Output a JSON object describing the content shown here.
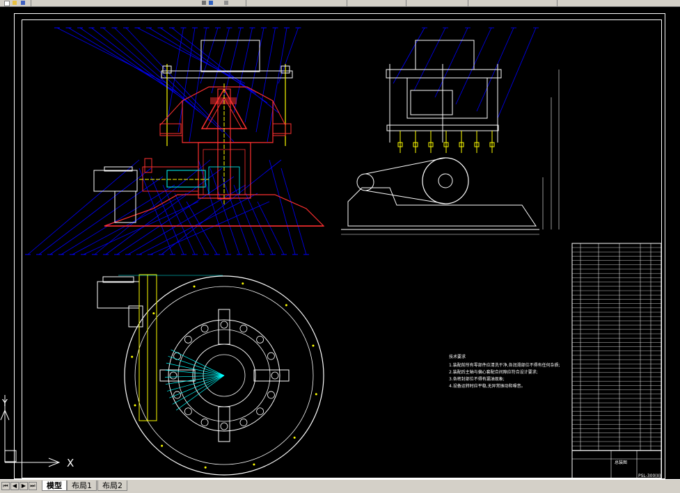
{
  "app": {
    "name": "AutoCAD"
  },
  "colors": {
    "background": "#000000",
    "leader": "#0000ff",
    "outline": "#ffffff",
    "section": "#ff3030",
    "machine": "#ffff00",
    "dim": "#00ffff",
    "center": "#00ff00"
  },
  "tabs": [
    {
      "label": "模型",
      "active": true
    },
    {
      "label": "布局1",
      "active": false
    },
    {
      "label": "布局2",
      "active": false
    }
  ],
  "ucs": {
    "x_label": "X",
    "y_label": "Y"
  },
  "notes": {
    "title": "技术要求",
    "lines": [
      "1.装配前所有零部件应清洗干净,各润滑部位不得有任何杂质;",
      "2.装配后主轴与偏心套配合间隙应符合设计要求;",
      "3.各密封部位不得有漏油现象;",
      "4.设备运转时应平稳,无异常振动和噪音。"
    ]
  },
  "title_block": {
    "name": "总装图",
    "drawing_no": "PSL-300(II)"
  }
}
